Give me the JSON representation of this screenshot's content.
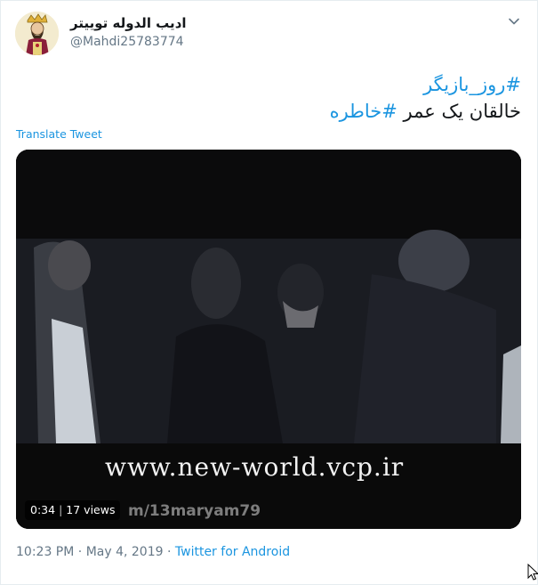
{
  "user": {
    "name": "ادیب الدوله توییتر",
    "handle": "@Mahdi25783774"
  },
  "tweet": {
    "hashtag1": "#روز_بازیگر",
    "line2_text": "خالقان یک عمر ",
    "hashtag2": "#خاطره"
  },
  "translate_label": "Translate Tweet",
  "video": {
    "watermark_site": "www.new-world.vcp.ir",
    "watermark_user": "m/13maryam79",
    "duration": "0:34",
    "separator": "|",
    "views": "17 views"
  },
  "footer": {
    "time": "10:23 PM",
    "dot1": " · ",
    "date": "May 4, 2019",
    "dot2": " · ",
    "source": "Twitter for Android"
  },
  "colors": {
    "link": "#1b95e0",
    "secondary_text": "#657786",
    "primary_text": "#14171a"
  },
  "icons": [
    "avatar-crowned-figure-icon",
    "chevron-down-icon",
    "mouse-cursor-icon"
  ]
}
